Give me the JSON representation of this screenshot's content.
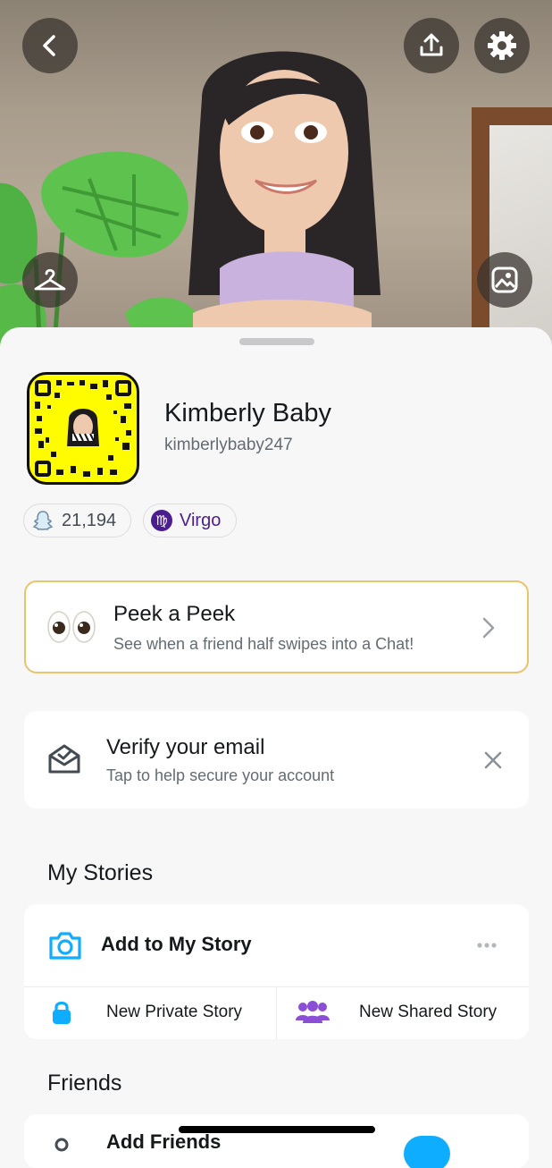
{
  "profile": {
    "display_name": "Kimberly Baby",
    "username": "kimberlybaby247",
    "score": "21,194",
    "zodiac": "Virgo"
  },
  "peek": {
    "title": "Peek a Peek",
    "subtitle": "See when a friend half swipes into a Chat!"
  },
  "verify": {
    "title": "Verify your email",
    "subtitle": "Tap to help secure your account"
  },
  "stories": {
    "heading": "My Stories",
    "add_label": "Add to My Story",
    "private_label": "New Private Story",
    "shared_label": "New Shared Story"
  },
  "friends": {
    "heading": "Friends",
    "add_label": "Add Friends"
  },
  "colors": {
    "snapcode_yellow": "#fffc00",
    "accent_blue": "#0fadff",
    "purple": "#8b4fd6",
    "peek_border": "#e8c46a"
  },
  "icons": [
    "back-icon",
    "upload-icon",
    "settings-icon",
    "hanger-icon",
    "gallery-icon",
    "ghost-icon",
    "virgo-icon",
    "eyes-icon",
    "chevron-right-icon",
    "mail-check-icon",
    "close-icon",
    "camera-icon",
    "more-icon",
    "lock-icon",
    "group-icon",
    "add-friend-icon"
  ]
}
